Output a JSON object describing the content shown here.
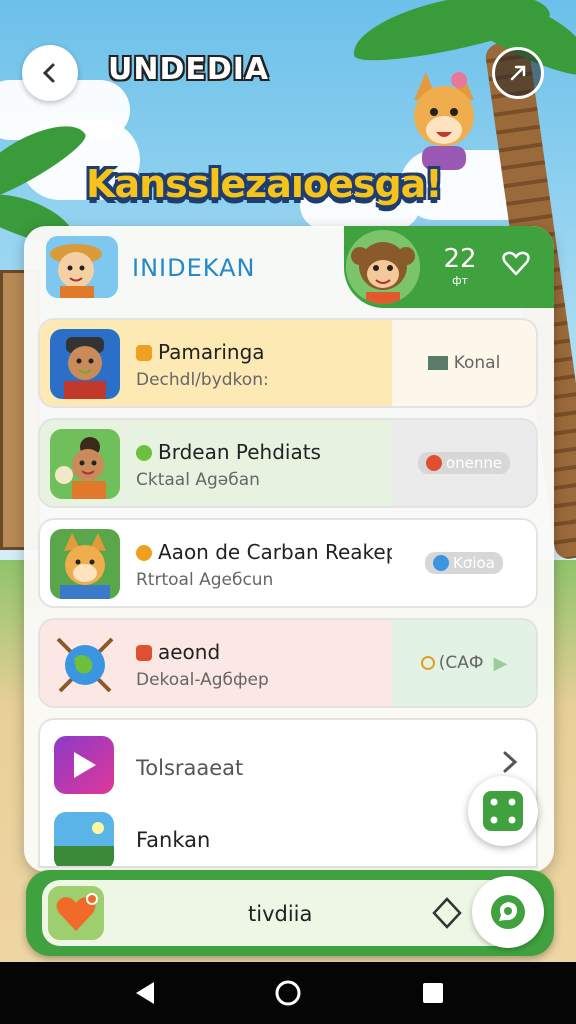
{
  "app": {
    "title": "UNDEDIA",
    "banner": "Kansslezaıoesga!"
  },
  "panel_header": {
    "title": "INIDEKAN",
    "count": "22",
    "count_sub": "фт"
  },
  "cards": [
    {
      "name": "Pamaringa",
      "sub": "Dechdl/bydkon:",
      "action": "Konal",
      "dot_color": "#f0a020",
      "bg": "#fde9b4",
      "action_bg": "#fdf6ea"
    },
    {
      "name": "Brdean Pehdiats",
      "sub": "Cktaal Agəбаn",
      "action": "onenne",
      "dot_color": "#e05030",
      "bg": "#e7f2e1",
      "action_bg": "#ebebeb",
      "prefix_color": "#6fbf3f"
    },
    {
      "name": "Aaon de Carban Reakep",
      "sub": "Rtrtoal Agебсun",
      "action": "Kσioa",
      "dot_color": "#3a96e0",
      "bg": "#ffffff",
      "action_bg": "#ffffff",
      "prefix_color": "#f0a020"
    },
    {
      "name": "aeond",
      "sub": "Dekoal-Agбфер",
      "action": "(САФ",
      "dot_color": "#f0a020",
      "bg": "#fbe7e4",
      "action_bg": "#e2f3e6",
      "prefix_color": "#e05030"
    }
  ],
  "list": [
    {
      "label": "Tolsraaeat"
    },
    {
      "label": "Fankan"
    }
  ],
  "bottom_bar": {
    "label": "tivdiia"
  },
  "colors": {
    "primary_green": "#3fa23f",
    "header_title_blue": "#2788c8",
    "banner_yellow": "#f6c21c"
  },
  "icons": {
    "back": "chevron-left-icon",
    "share": "share-icon",
    "favorite": "heart-outline-icon",
    "dice": "dice-icon",
    "chat": "chat-icon",
    "heart": "heart-icon",
    "diamond": "diamond-icon"
  }
}
